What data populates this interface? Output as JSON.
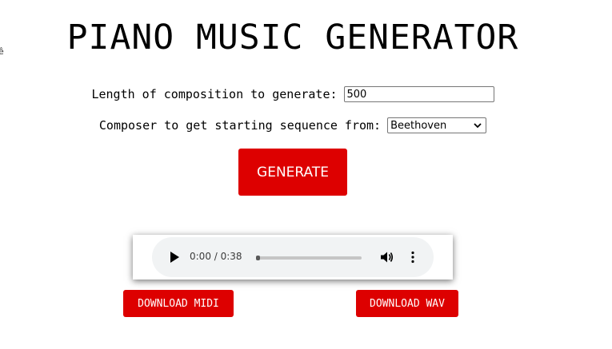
{
  "edge_glyph": "ê",
  "page_title": "PIANO MUSIC GENERATOR",
  "form": {
    "length_label": "Length of composition to generate:",
    "length_value": "500",
    "composer_label": "Composer to get starting sequence from:",
    "composer_selected": "Beethoven"
  },
  "generate_label": "GENERATE",
  "player": {
    "time": "0:00 / 0:38",
    "progress_fraction": 0.0
  },
  "downloads": {
    "midi_label": "DOWNLOAD MIDI",
    "wav_label": "DOWNLOAD WAV"
  },
  "colors": {
    "accent": "#dd0000",
    "player_bg": "#f1f3f4"
  },
  "icons": [
    "play-icon",
    "volume-icon",
    "more-options-icon",
    "chevron-down-icon"
  ]
}
